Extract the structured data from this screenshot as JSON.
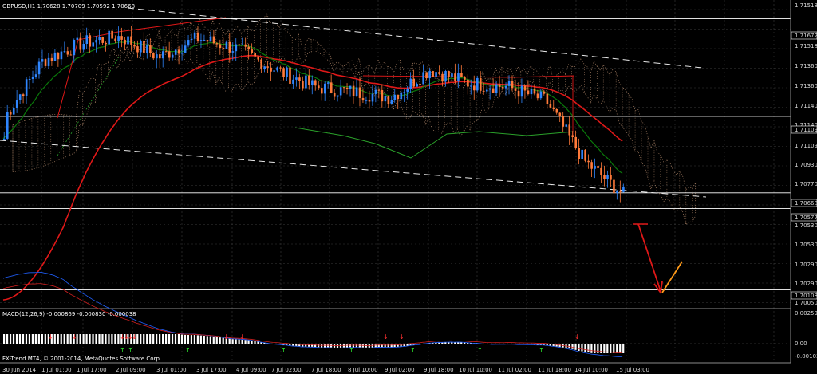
{
  "header": {
    "symbol_text": "GBPUSD,H1  1.70628 1.70709 1.70592 1.70668"
  },
  "colors": {
    "background": "#000000",
    "bull": "#2f86ff",
    "bear": "#ff7a3a",
    "ema_fast": "#0a7a0a",
    "ema_slow": "#e01818",
    "cloud": "#f0b890",
    "macd_main": "#2060ff",
    "macd_signal": "#d02020",
    "hist": "#ffffff",
    "grid": "#3a3a3a",
    "hline": "#ffffff",
    "channel": "#e8e8e8",
    "arrow_down": "#e01818",
    "arrow_up": "#ff9a1a"
  },
  "price_axis": {
    "ticks": [
      "1.71518",
      "1.71672",
      "1.71360",
      "1.71140",
      "1.71109",
      "1.70930",
      "1.70770",
      "1.70668",
      "1.70577",
      "1.70530",
      "1.70290",
      "1.70108",
      "1.70050"
    ]
  },
  "time_axis": {
    "ticks": [
      "30 Jun 2014",
      "1 Jul 01:00",
      "1 Jul 17:00",
      "2 Jul 09:00",
      "3 Jul 01:00",
      "3 Jul 17:00",
      "4 Jul 09:00",
      "7 Jul 02:00",
      "7 Jul 18:00",
      "8 Jul 10:00",
      "9 Jul 02:00",
      "9 Jul 18:00",
      "10 Jul 10:00",
      "11 Jul 02:00",
      "11 Jul 18:00",
      "14 Jul 10:00",
      "15 Jul 03:00"
    ]
  },
  "chart_data": {
    "type": "line",
    "symbol": "GBPUSD",
    "timeframe": "H1",
    "last_bar": {
      "open": 1.70628,
      "high": 1.70709,
      "low": 1.70592,
      "close": 1.70668
    },
    "ylim": [
      1.7,
      1.7178
    ],
    "x": [
      "30 Jun 2014",
      "1 Jul 01:00",
      "1 Jul 17:00",
      "2 Jul 09:00",
      "3 Jul 01:00",
      "3 Jul 17:00",
      "4 Jul 09:00",
      "7 Jul 02:00",
      "7 Jul 18:00",
      "8 Jul 10:00",
      "9 Jul 02:00",
      "9 Jul 18:00",
      "10 Jul 10:00",
      "11 Jul 02:00",
      "11 Jul 18:00",
      "14 Jul 10:00",
      "15 Jul 03:00"
    ],
    "series": [
      {
        "values": [
          1.711,
          1.7143,
          1.7153,
          1.7157,
          1.7145,
          1.7156,
          1.715,
          1.7138,
          1.7128,
          1.7125,
          1.7122,
          1.7138,
          1.713,
          1.7128,
          1.712,
          1.7085,
          1.7066
        ]
      }
    ],
    "horizontal_levels": [
      1.71672,
      1.71109,
      1.70668,
      1.70577,
      1.70108
    ],
    "price_labels": [
      "1.71518",
      "1.71672",
      "1.71360",
      "1.71140",
      "1.71109",
      "1.70930",
      "1.70770",
      "1.70668",
      "1.70577",
      "1.70530",
      "1.70290",
      "1.70108",
      "1.70050"
    ]
  },
  "macd": {
    "header_text": "MACD(12,26,9) -0.000869 -0.000830 -0.000038",
    "axis": [
      "0.002592",
      "0.00",
      "-0.001036"
    ]
  },
  "footer": {
    "text": "FX-Trend MT4, © 2001-2014, MetaQuotes Software Corp."
  }
}
